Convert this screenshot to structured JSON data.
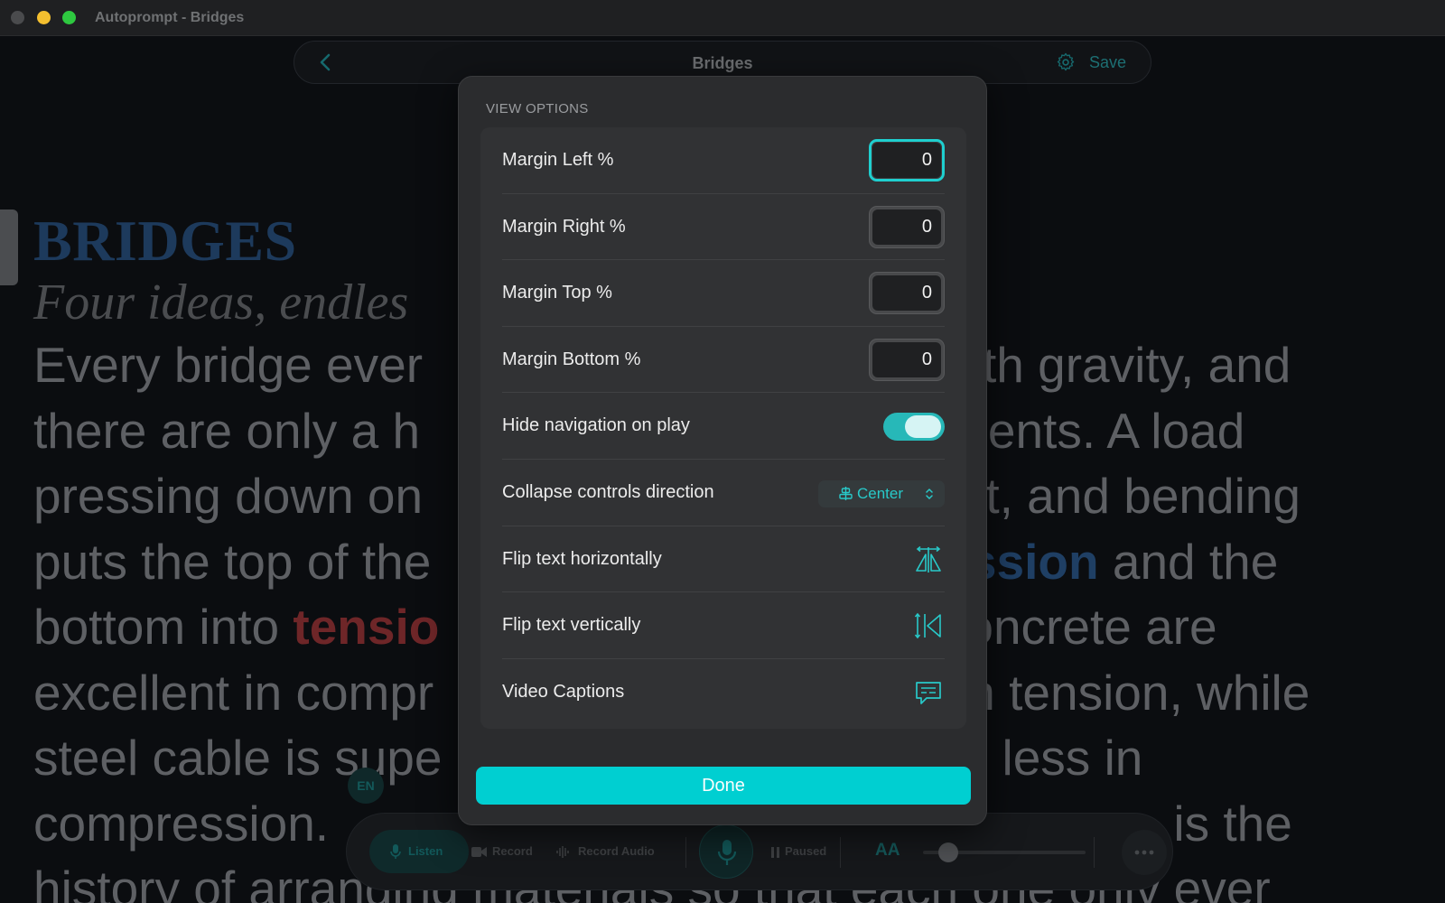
{
  "window": {
    "title": "Autoprompt - Bridges"
  },
  "toolbar": {
    "doc_title": "Bridges",
    "save_label": "Save"
  },
  "document": {
    "heading": "BRIDGES",
    "subheading": "Four ideas, endles",
    "lines": [
      [
        "Every bridge ever",
        "with gravity, and"
      ],
      [
        "there are only a h",
        "ments. A load"
      ],
      [
        "pressing down on",
        "it, and bending"
      ],
      [
        "puts the top of the",
        "ession",
        "and the"
      ],
      [
        "bottom into",
        "tensio",
        "oncrete are"
      ],
      [
        "excellent in compr",
        "n tension, while"
      ],
      [
        "steel cable is supe",
        "less in"
      ],
      [
        "compression. ",
        "is the"
      ],
      [
        "history of arranging materials so that each one only ever"
      ]
    ]
  },
  "bottom_bar": {
    "listen": "Listen",
    "record": "Record",
    "record_audio": "Record Audio",
    "status": "Paused",
    "font_size_icon": "AA",
    "language": "EN"
  },
  "view_options": {
    "header": "VIEW OPTIONS",
    "margin_left_label": "Margin Left %",
    "margin_left_value": "0",
    "margin_right_label": "Margin Right %",
    "margin_right_value": "0",
    "margin_top_label": "Margin Top %",
    "margin_top_value": "0",
    "margin_bottom_label": "Margin Bottom %",
    "margin_bottom_value": "0",
    "hide_nav_label": "Hide navigation on play",
    "hide_nav_on": true,
    "collapse_label": "Collapse controls direction",
    "collapse_value": "Center",
    "flip_h_label": "Flip text horizontally",
    "flip_v_label": "Flip text vertically",
    "captions_label": "Video Captions",
    "done_label": "Done"
  },
  "colors": {
    "accent": "#00cfd1",
    "heading_blue": "#1d3a5c",
    "tension_red": "#6e2628"
  }
}
